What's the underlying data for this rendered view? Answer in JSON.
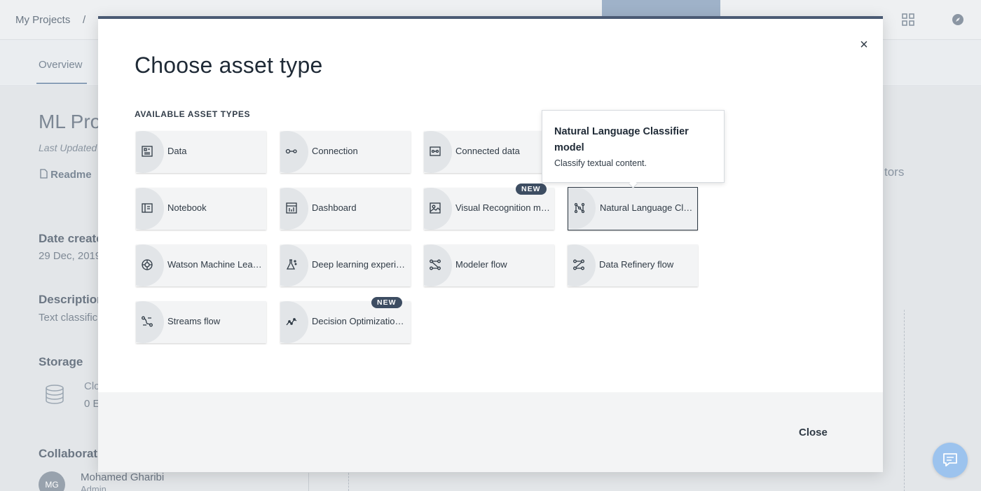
{
  "background": {
    "breadcrumb": {
      "root": "My Projects",
      "separator": "/"
    },
    "tabs": {
      "overview": "Overview"
    },
    "project": {
      "title": "ML Proj",
      "last_updated": "Last Updated",
      "readme": "Readme",
      "side_text": "tors",
      "date_created_label": "Date create",
      "date_created_value": "29 Dec, 2019",
      "description_label": "Description",
      "description_value": "Text classific",
      "storage_label": "Storage",
      "storage_line1": "Clo",
      "storage_line2": "0 E",
      "collaborators_label": "Collaborat",
      "member_initials": "MG",
      "member_name": "Mohamed Gharibi",
      "member_role": "Admin"
    }
  },
  "modal": {
    "title": "Choose asset type",
    "section_label": "AVAILABLE ASSET TYPES",
    "close_icon": "×",
    "close_button": "Close",
    "badge_new": "NEW",
    "tiles": [
      {
        "label": "Data",
        "icon": "data-icon"
      },
      {
        "label": "Connection",
        "icon": "connection-icon"
      },
      {
        "label": "Connected data",
        "icon": "connected-data-icon"
      },
      {
        "label": "Notebook",
        "icon": "notebook-icon"
      },
      {
        "label": "Dashboard",
        "icon": "dashboard-icon"
      },
      {
        "label": "Visual Recognition model",
        "icon": "visual-recognition-icon",
        "badge": "NEW"
      },
      {
        "label": "Natural Language Classifier model",
        "icon": "nlc-icon",
        "selected": true
      },
      {
        "label": "Watson Machine Learning model",
        "icon": "wml-icon"
      },
      {
        "label": "Deep learning experiment",
        "icon": "flask-icon"
      },
      {
        "label": "Modeler flow",
        "icon": "modeler-flow-icon"
      },
      {
        "label": "Data Refinery flow",
        "icon": "data-refinery-icon"
      },
      {
        "label": "Streams flow",
        "icon": "streams-flow-icon"
      },
      {
        "label": "Decision Optimization model",
        "icon": "decision-optimization-icon",
        "badge": "NEW"
      }
    ],
    "tooltip": {
      "title": "Natural Language Classifier model",
      "description": "Classify textual content."
    }
  },
  "colors": {
    "accent": "#4a5a73",
    "badge": "#3d4d62",
    "fab": "#9cc3ee"
  }
}
